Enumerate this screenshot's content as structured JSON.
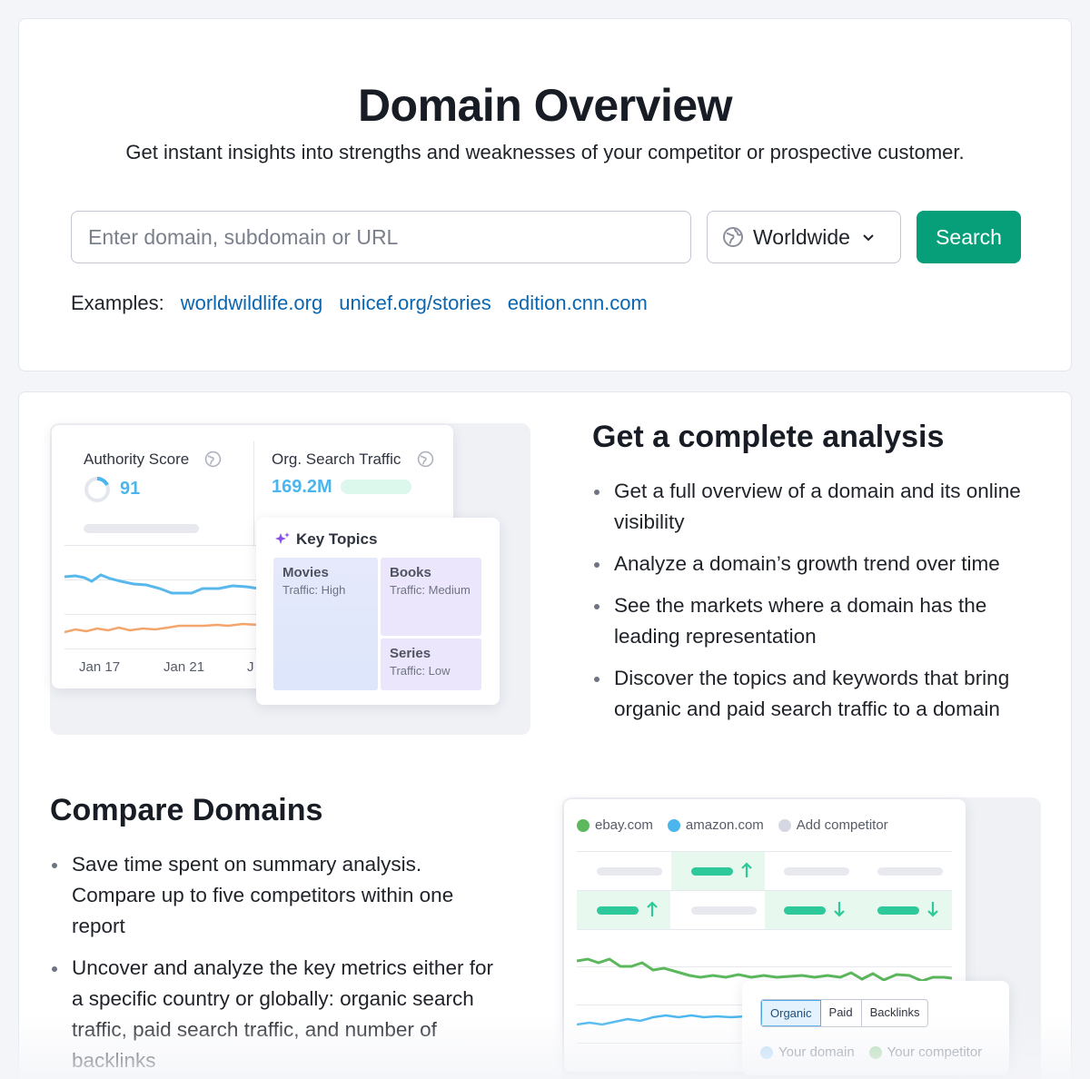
{
  "hero": {
    "title": "Domain Overview",
    "subtitle": "Get instant insights into strengths and weaknesses of your competitor or prospective customer.",
    "search_input": {
      "value": "",
      "placeholder": "Enter domain, subdomain or URL"
    },
    "region_select": {
      "value": "Worldwide",
      "icon": "globe-icon"
    },
    "search_button": "Search",
    "examples_label": "Examples:",
    "examples": [
      "worldwildlife.org",
      "unicef.org/stories",
      "edition.cnn.com"
    ]
  },
  "analysis": {
    "heading": "Get a complete analysis",
    "bullets": [
      "Get a full overview of a domain and its online visibility",
      "Analyze a domain’s growth trend over time",
      "See the markets where a domain has the leading representation",
      "Discover the topics and keywords that bring organic and paid search traffic to a domain"
    ],
    "illustration": {
      "authority_label": "Authority Score",
      "authority_value": "91",
      "traffic_label": "Org. Search Traffic",
      "traffic_value": "169.2M",
      "dates": [
        "Jan 17",
        "Jan 21",
        "J"
      ],
      "key_topics_title": "Key Topics",
      "topics": [
        {
          "name": "Movies",
          "traffic": "Traffic: High"
        },
        {
          "name": "Books",
          "traffic": "Traffic: Medium"
        },
        {
          "name": "Series",
          "traffic": "Traffic: Low"
        }
      ]
    }
  },
  "compare": {
    "heading": "Compare Domains",
    "bullets": [
      "Save time spent on summary analysis. Compare up to five competitors within one report",
      "Uncover and analyze the key metrics either for a specific country or globally: organic search traffic, paid search traffic, and number of backlinks"
    ],
    "illustration": {
      "legend": [
        "ebay.com",
        "amazon.com",
        "Add competitor"
      ],
      "tabs": [
        "Organic",
        "Paid",
        "Backlinks"
      ],
      "active_tab": "Organic",
      "legend2": [
        "Your domain",
        "Your competitor"
      ]
    }
  },
  "colors": {
    "accent": "#079e7a",
    "link": "#0b66b0",
    "blue": "#4bb6ee",
    "green": "#5cb85c",
    "orange": "#f4a56b"
  }
}
